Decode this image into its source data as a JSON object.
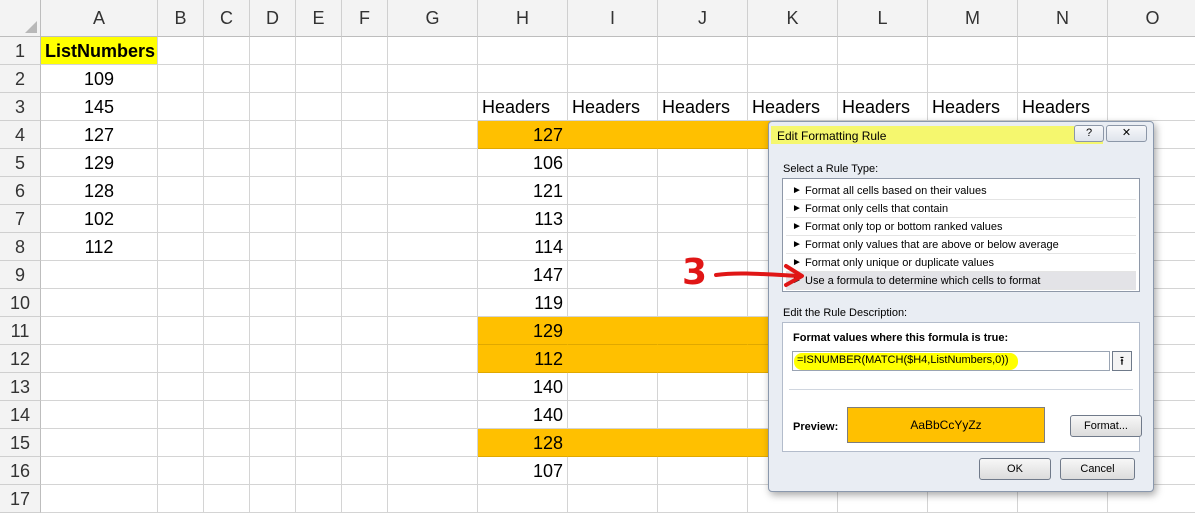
{
  "sheet": {
    "columns": [
      "A",
      "B",
      "C",
      "D",
      "E",
      "F",
      "G",
      "H",
      "I",
      "J",
      "K",
      "L",
      "M",
      "N",
      "O"
    ],
    "rows": [
      "1",
      "2",
      "3",
      "4",
      "5",
      "6",
      "7",
      "8",
      "9",
      "10",
      "11",
      "12",
      "13",
      "14",
      "15",
      "16",
      "17"
    ],
    "listnumbers_header": "ListNumbers",
    "listnumbers": [
      "109",
      "145",
      "127",
      "129",
      "128",
      "102",
      "112"
    ],
    "headers": [
      "Headers",
      "Headers",
      "Headers",
      "Headers",
      "Headers",
      "Headers",
      "Headers"
    ],
    "h_values": [
      "127",
      "106",
      "121",
      "113",
      "114",
      "147",
      "119",
      "129",
      "112",
      "140",
      "140",
      "128",
      "107"
    ],
    "highlight_color": "#ffc000",
    "name_highlight_color": "#ffff00"
  },
  "dialog": {
    "title": "Edit Formatting Rule",
    "help_label": "?",
    "close_label": "✕",
    "select_rule_type_label": "Select a Rule Type:",
    "rule_types": [
      "Format all cells based on their values",
      "Format only cells that contain",
      "Format only top or bottom ranked values",
      "Format only values that are above or below average",
      "Format only unique or duplicate values",
      "Use a formula to determine which cells to format"
    ],
    "selected_rule_index": 5,
    "edit_description_label": "Edit the Rule Description:",
    "formula_label": "Format values where this formula is true:",
    "formula_value": "=ISNUMBER(MATCH($H4,ListNumbers,0))",
    "preview_label": "Preview:",
    "preview_text": "AaBbCcYyZz",
    "preview_color": "#ffc000",
    "format_button": "Format...",
    "ok_button": "OK",
    "cancel_button": "Cancel"
  },
  "annotation": {
    "number": "3",
    "color": "#e01616"
  }
}
